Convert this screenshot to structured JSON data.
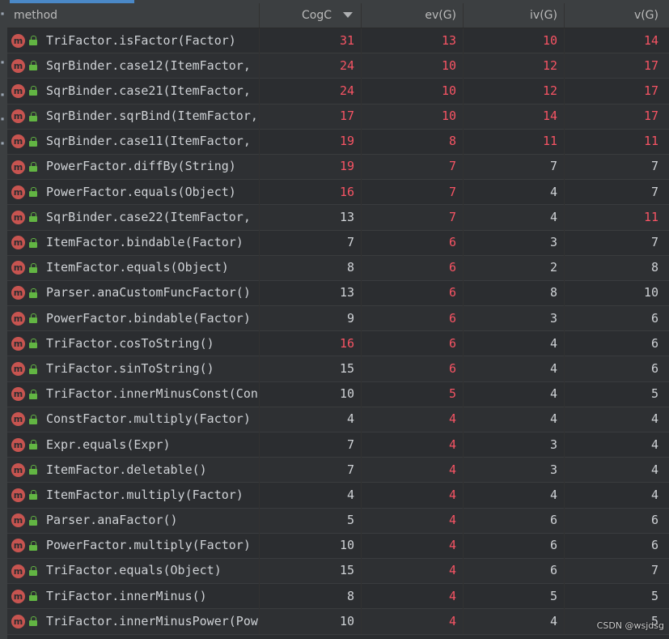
{
  "header": {
    "method": "method",
    "cogc": "CogC",
    "ev": "ev(G)",
    "iv": "iv(G)",
    "v": "v(G)"
  },
  "colors": {
    "red": "#f75464",
    "normal": "#cfd2d6",
    "method_icon": "#c75450",
    "lock": "#62b543"
  },
  "icons": {
    "method": "method-m-icon",
    "visibility": "lock-icon",
    "sort": "sort-desc-icon"
  },
  "rows": [
    {
      "method": "TriFactor.isFactor(Factor)",
      "cogc": "31",
      "ev": "13",
      "iv": "10",
      "v": "14",
      "red": [
        true,
        true,
        true,
        true
      ]
    },
    {
      "method": "SqrBinder.case12(ItemFactor,",
      "cogc": "24",
      "ev": "10",
      "iv": "12",
      "v": "17",
      "red": [
        true,
        true,
        true,
        true
      ]
    },
    {
      "method": "SqrBinder.case21(ItemFactor,",
      "cogc": "24",
      "ev": "10",
      "iv": "12",
      "v": "17",
      "red": [
        true,
        true,
        true,
        true
      ]
    },
    {
      "method": "SqrBinder.sqrBind(ItemFactor,",
      "cogc": "17",
      "ev": "10",
      "iv": "14",
      "v": "17",
      "red": [
        true,
        true,
        true,
        true
      ]
    },
    {
      "method": "SqrBinder.case11(ItemFactor,",
      "cogc": "19",
      "ev": "8",
      "iv": "11",
      "v": "11",
      "red": [
        true,
        true,
        true,
        true
      ]
    },
    {
      "method": "PowerFactor.diffBy(String)",
      "cogc": "19",
      "ev": "7",
      "iv": "7",
      "v": "7",
      "red": [
        true,
        true,
        false,
        false
      ]
    },
    {
      "method": "PowerFactor.equals(Object)",
      "cogc": "16",
      "ev": "7",
      "iv": "4",
      "v": "7",
      "red": [
        true,
        true,
        false,
        false
      ]
    },
    {
      "method": "SqrBinder.case22(ItemFactor,",
      "cogc": "13",
      "ev": "7",
      "iv": "4",
      "v": "11",
      "red": [
        false,
        true,
        false,
        true
      ]
    },
    {
      "method": "ItemFactor.bindable(Factor)",
      "cogc": "7",
      "ev": "6",
      "iv": "3",
      "v": "7",
      "red": [
        false,
        true,
        false,
        false
      ]
    },
    {
      "method": "ItemFactor.equals(Object)",
      "cogc": "8",
      "ev": "6",
      "iv": "2",
      "v": "8",
      "red": [
        false,
        true,
        false,
        false
      ]
    },
    {
      "method": "Parser.anaCustomFuncFactor()",
      "cogc": "13",
      "ev": "6",
      "iv": "8",
      "v": "10",
      "red": [
        false,
        true,
        false,
        false
      ]
    },
    {
      "method": "PowerFactor.bindable(Factor)",
      "cogc": "9",
      "ev": "6",
      "iv": "3",
      "v": "6",
      "red": [
        false,
        true,
        false,
        false
      ]
    },
    {
      "method": "TriFactor.cosToString()",
      "cogc": "16",
      "ev": "6",
      "iv": "4",
      "v": "6",
      "red": [
        true,
        true,
        false,
        false
      ]
    },
    {
      "method": "TriFactor.sinToString()",
      "cogc": "15",
      "ev": "6",
      "iv": "4",
      "v": "6",
      "red": [
        false,
        true,
        false,
        false
      ]
    },
    {
      "method": "TriFactor.innerMinusConst(Con",
      "cogc": "10",
      "ev": "5",
      "iv": "4",
      "v": "5",
      "red": [
        false,
        true,
        false,
        false
      ]
    },
    {
      "method": "ConstFactor.multiply(Factor)",
      "cogc": "4",
      "ev": "4",
      "iv": "4",
      "v": "4",
      "red": [
        false,
        true,
        false,
        false
      ]
    },
    {
      "method": "Expr.equals(Expr)",
      "cogc": "7",
      "ev": "4",
      "iv": "3",
      "v": "4",
      "red": [
        false,
        true,
        false,
        false
      ]
    },
    {
      "method": "ItemFactor.deletable()",
      "cogc": "7",
      "ev": "4",
      "iv": "3",
      "v": "4",
      "red": [
        false,
        true,
        false,
        false
      ]
    },
    {
      "method": "ItemFactor.multiply(Factor)",
      "cogc": "4",
      "ev": "4",
      "iv": "4",
      "v": "4",
      "red": [
        false,
        true,
        false,
        false
      ]
    },
    {
      "method": "Parser.anaFactor()",
      "cogc": "5",
      "ev": "4",
      "iv": "6",
      "v": "6",
      "red": [
        false,
        true,
        false,
        false
      ]
    },
    {
      "method": "PowerFactor.multiply(Factor)",
      "cogc": "10",
      "ev": "4",
      "iv": "6",
      "v": "6",
      "red": [
        false,
        true,
        false,
        false
      ]
    },
    {
      "method": "TriFactor.equals(Object)",
      "cogc": "15",
      "ev": "4",
      "iv": "6",
      "v": "7",
      "red": [
        false,
        true,
        false,
        false
      ]
    },
    {
      "method": "TriFactor.innerMinus()",
      "cogc": "8",
      "ev": "4",
      "iv": "5",
      "v": "5",
      "red": [
        false,
        true,
        false,
        false
      ]
    },
    {
      "method": "TriFactor.innerMinusPower(Pow",
      "cogc": "10",
      "ev": "4",
      "iv": "4",
      "v": "5",
      "red": [
        false,
        true,
        false,
        false
      ]
    }
  ],
  "watermark": "CSDN @wsjdsg"
}
